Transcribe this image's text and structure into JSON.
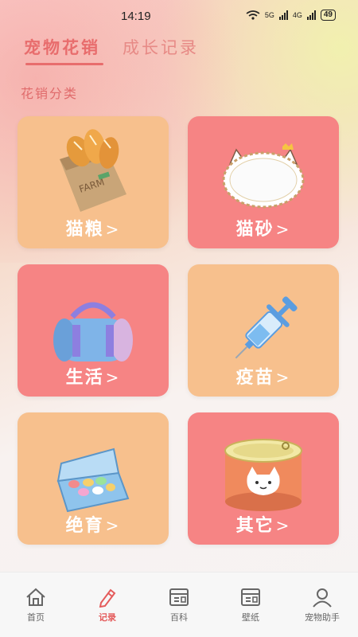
{
  "status": {
    "time": "14:19",
    "network1": "5G",
    "network2": "4G",
    "battery": "49"
  },
  "top_tabs": [
    {
      "label": "宠物花销",
      "active": true
    },
    {
      "label": "成长记录",
      "active": false
    }
  ],
  "section_title": "花销分类",
  "categories": [
    {
      "label": "猫粮",
      "chevron": ">",
      "color": "#f7c08d",
      "icon": "bread-bag-icon"
    },
    {
      "label": "猫砂",
      "chevron": ">",
      "color": "#f68484",
      "icon": "cat-mirror-icon"
    },
    {
      "label": "生活",
      "chevron": ">",
      "color": "#f68484",
      "icon": "duffel-bag-icon"
    },
    {
      "label": "疫苗",
      "chevron": ">",
      "color": "#f7c08d",
      "icon": "syringe-icon"
    },
    {
      "label": "绝育",
      "chevron": ">",
      "color": "#f7c08d",
      "icon": "pill-box-icon"
    },
    {
      "label": "其它",
      "chevron": ">",
      "color": "#f68484",
      "icon": "cat-can-icon"
    }
  ],
  "bottom_nav": [
    {
      "label": "首页",
      "icon": "home-icon",
      "active": false
    },
    {
      "label": "记录",
      "icon": "pen-icon",
      "active": true
    },
    {
      "label": "百科",
      "icon": "book-icon",
      "active": false
    },
    {
      "label": "壁纸",
      "icon": "wallpaper-icon",
      "active": false
    },
    {
      "label": "宠物助手",
      "icon": "user-icon",
      "active": false
    }
  ],
  "colors": {
    "accent": "#e86d6d",
    "card_orange": "#f7c08d",
    "card_pink": "#f68484"
  }
}
